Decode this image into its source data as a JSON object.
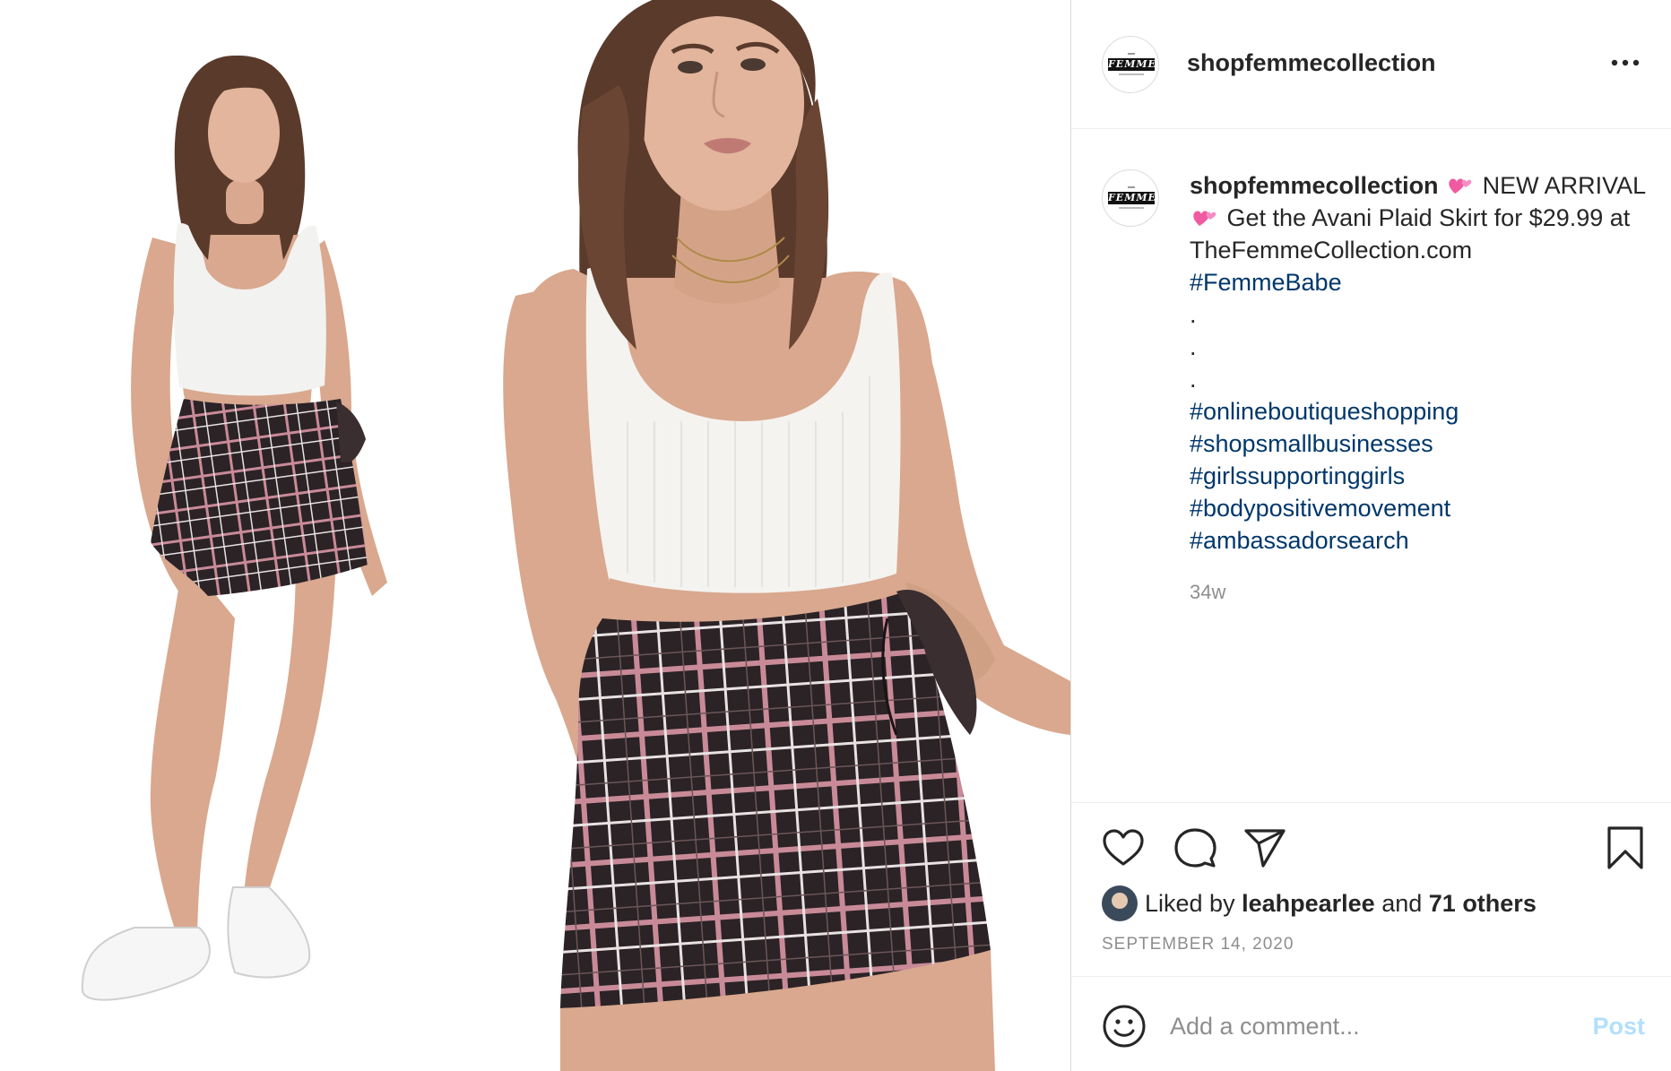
{
  "post": {
    "username": "shopfemmecollection",
    "avatar_logo_text": "FEMME",
    "caption": {
      "username": "shopfemmecollection",
      "line1_a": "NEW ARRIVAL",
      "line1_b": "Get the Avani Plaid Skirt for $29.99 at TheFemmeCollection.com",
      "hashtag_main": "#FemmeBabe",
      "dots": [
        ".",
        ".",
        "."
      ],
      "hashtags": [
        "#onlineboutiqueshopping",
        "#shopsmallbusinesses",
        "#girlssupportinggirls",
        "#bodypositivemovement",
        "#ambassadorsearch"
      ],
      "time_ago": "34w"
    },
    "likes": {
      "prefix": "Liked by",
      "user": "leahpearlee",
      "joiner": "and",
      "others": "71 others"
    },
    "date": "SEPTEMBER 14, 2020",
    "comment": {
      "placeholder": "Add a comment...",
      "post_label": "Post"
    }
  },
  "icons": {
    "more": "more-options-icon",
    "like": "heart-icon",
    "comment": "comment-bubble-icon",
    "share": "paper-plane-icon",
    "save": "bookmark-icon",
    "emoji": "smiley-icon",
    "caption_emoji": "two-hearts-icon"
  },
  "colors": {
    "hashtag": "#00376b",
    "text": "#262626",
    "muted": "#8e8e8e",
    "post_disabled": "#b2dffc",
    "divider": "#efefef"
  }
}
